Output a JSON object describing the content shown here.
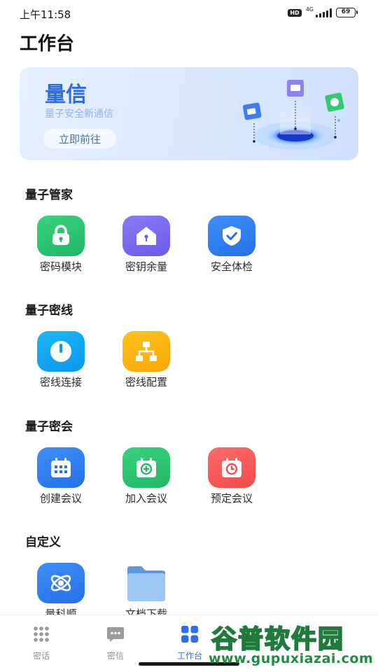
{
  "status_bar": {
    "time": "上午11:58",
    "hd": "HD",
    "network": "4G",
    "battery": "69"
  },
  "header": {
    "title": "工作台"
  },
  "banner": {
    "title": "量信",
    "subtitle": "量子安全新通信",
    "button_label": "立即前往"
  },
  "sections": [
    {
      "title": "量子管家",
      "items": [
        {
          "label": "密码模块",
          "icon": "lock-icon",
          "color": "#22b868"
        },
        {
          "label": "密钥余量",
          "icon": "key-house-icon",
          "color": "#6c5cea"
        },
        {
          "label": "安全体检",
          "icon": "shield-check-icon",
          "color": "#2572ea"
        }
      ]
    },
    {
      "title": "量子密线",
      "items": [
        {
          "label": "密线连接",
          "icon": "power-icon",
          "color": "#0a9bea"
        },
        {
          "label": "密线配置",
          "icon": "network-config-icon",
          "color": "#f5aa0c"
        }
      ]
    },
    {
      "title": "量子密会",
      "items": [
        {
          "label": "创建会议",
          "icon": "calendar-icon",
          "color": "#2572ea"
        },
        {
          "label": "加入会议",
          "icon": "join-meeting-icon",
          "color": "#22b868"
        },
        {
          "label": "预定会议",
          "icon": "schedule-meeting-icon",
          "color": "#f04b4b"
        }
      ]
    },
    {
      "title": "自定义",
      "items": [
        {
          "label": "量科顺",
          "icon": "atom-icon",
          "color": "#2572ea"
        },
        {
          "label": "文档下载",
          "icon": "folder-icon",
          "color": "#7fb4ea"
        }
      ]
    }
  ],
  "bottom_nav": {
    "items": [
      {
        "label": "密话",
        "icon": "dialpad-icon",
        "active": false
      },
      {
        "label": "密信",
        "icon": "message-icon",
        "active": false
      },
      {
        "label": "工作台",
        "icon": "grid-icon",
        "active": true
      }
    ]
  },
  "watermark": {
    "title": "谷普软件园",
    "url": "www.gupuxiazai.com"
  },
  "colors": {
    "accent": "#2d6ff0",
    "banner_title": "#2a6de0"
  }
}
